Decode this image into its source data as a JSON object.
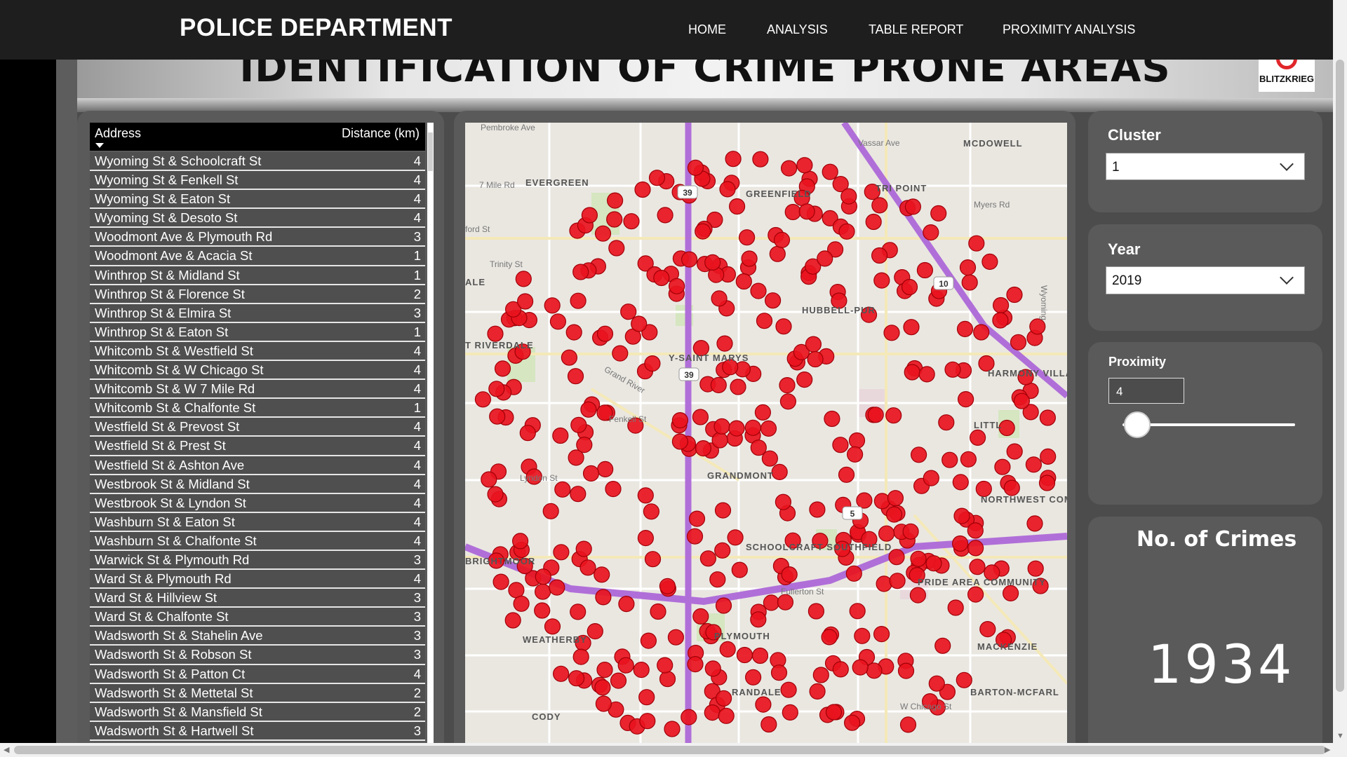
{
  "header": {
    "brand": "POLICE DEPARTMENT",
    "nav": [
      "HOME",
      "ANALYSIS",
      "TABLE REPORT",
      "PROXIMITY ANALYSIS"
    ]
  },
  "report": {
    "title": "IDENTIFICATION OF CRIME PRONE AREAS",
    "logo_text": "BLITZKRIEG"
  },
  "table": {
    "columns": [
      "Address",
      "Distance (km)"
    ],
    "rows": [
      [
        "Wyoming St & Schoolcraft St",
        "4"
      ],
      [
        "Wyoming St & Fenkell St",
        "4"
      ],
      [
        "Wyoming St & Eaton St",
        "4"
      ],
      [
        "Wyoming St & Desoto St",
        "4"
      ],
      [
        "Woodmont Ave & Plymouth Rd",
        "3"
      ],
      [
        "Woodmont Ave & Acacia St",
        "1"
      ],
      [
        "Winthrop St & Midland St",
        "1"
      ],
      [
        "Winthrop St & Florence St",
        "2"
      ],
      [
        "Winthrop St & Elmira St",
        "3"
      ],
      [
        "Winthrop St & Eaton St",
        "1"
      ],
      [
        "Whitcomb St & Westfield St",
        "4"
      ],
      [
        "Whitcomb St & W Chicago St",
        "4"
      ],
      [
        "Whitcomb St & W 7 Mile Rd",
        "4"
      ],
      [
        "Whitcomb St & Chalfonte St",
        "1"
      ],
      [
        "Westfield St & Prevost St",
        "4"
      ],
      [
        "Westfield St & Prest St",
        "4"
      ],
      [
        "Westfield St & Ashton Ave",
        "4"
      ],
      [
        "Westbrook St & Midland St",
        "4"
      ],
      [
        "Westbrook St & Lyndon St",
        "4"
      ],
      [
        "Washburn St & Eaton St",
        "4"
      ],
      [
        "Washburn St & Chalfonte St",
        "4"
      ],
      [
        "Warwick St & Plymouth Rd",
        "3"
      ],
      [
        "Ward St & Plymouth Rd",
        "4"
      ],
      [
        "Ward St & Hillview St",
        "3"
      ],
      [
        "Ward St & Chalfonte St",
        "3"
      ],
      [
        "Wadsworth St & Stahelin Ave",
        "3"
      ],
      [
        "Wadsworth St & Robson St",
        "3"
      ],
      [
        "Wadsworth St & Patton Ct",
        "4"
      ],
      [
        "Wadsworth St & Mettetal St",
        "2"
      ],
      [
        "Wadsworth St & Mansfield St",
        "2"
      ],
      [
        "Wadsworth St & Hartwell St",
        "3"
      ]
    ]
  },
  "map": {
    "labels": [
      "Pembroke Ave",
      "Vassar Ave",
      "MCDOWELL",
      "EVERGREEN",
      "7 Mile Rd",
      "GREENFIELD",
      "TRI POINT",
      "Myers Rd",
      "ford St",
      "Trinity St",
      "ALE",
      "T RIVERDALE",
      "HUBBELL-PUR",
      "Y-SAINT MARYS",
      "HARMONY VILLAGE",
      "Grand River",
      "Fenkell St",
      "LITTL",
      "GRANDMONT",
      "Lyndon St",
      "NORTHWEST COMMUNITY",
      "BRIGHTMOOR",
      "SCHOOLCRAFT SOUTHFIELD",
      "Fullerton St",
      "PRIDE AREA COMMUNITY",
      "WEATHERBY",
      "PLYMOUTH",
      "MACKENZIE",
      "RANDALE",
      "BARTON-MCFARL",
      "CODY",
      "W Chicago St",
      "Wyoming"
    ],
    "shields": [
      "39",
      "39",
      "10",
      "5"
    ],
    "marker_color": "#e8141e",
    "marker_count": 420
  },
  "filters": {
    "cluster_label": "Cluster",
    "cluster_value": "1",
    "year_label": "Year",
    "year_value": "2019",
    "proximity_label": "Proximity",
    "proximity_value": "4"
  },
  "kpi": {
    "title": "No. of Crimes",
    "value": "1934"
  }
}
